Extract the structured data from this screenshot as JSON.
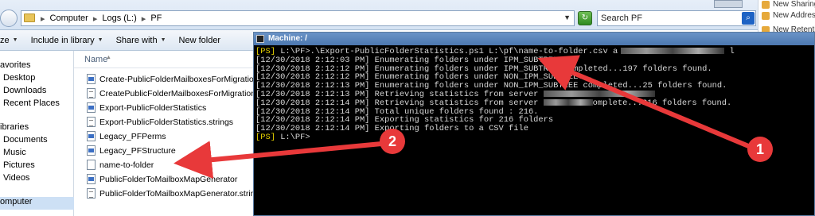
{
  "address": {
    "crumbs": [
      "Computer",
      "Logs (L:)",
      "PF"
    ],
    "separator": "▸"
  },
  "search": {
    "placeholder": "Search PF"
  },
  "outlook_panel": {
    "items": [
      "New Sharing",
      "New Address",
      "New Retenti"
    ]
  },
  "toolbar": {
    "organize_label": "ze",
    "include_label": "Include in library",
    "share_label": "Share with",
    "new_folder_label": "New folder"
  },
  "nav": {
    "favorites_head": "avorites",
    "favorites": [
      "Desktop",
      "Downloads",
      "Recent Places"
    ],
    "libraries_head": "ibraries",
    "libraries": [
      "Documents",
      "Music",
      "Pictures",
      "Videos"
    ],
    "computer_label": "omputer"
  },
  "filelist": {
    "column_name": "Name",
    "files": [
      {
        "name": "Create-PublicFolderMailboxesForMigration",
        "icon": "powershell-script-icon"
      },
      {
        "name": "CreatePublicFolderMailboxesForMigration.stri...",
        "icon": "strings-file-icon"
      },
      {
        "name": "Export-PublicFolderStatistics",
        "icon": "powershell-script-icon"
      },
      {
        "name": "Export-PublicFolderStatistics.strings",
        "icon": "strings-file-icon"
      },
      {
        "name": "Legacy_PFPerms",
        "icon": "powershell-script-icon"
      },
      {
        "name": "Legacy_PFStructure",
        "icon": "powershell-script-icon"
      },
      {
        "name": "name-to-folder",
        "icon": "text-file-icon"
      },
      {
        "name": "PublicFolderToMailboxMapGenerator",
        "icon": "powershell-script-icon"
      },
      {
        "name": "PublicFolderToMailboxMapGenerator.strings",
        "icon": "strings-file-icon"
      }
    ]
  },
  "console": {
    "title": "Machine: /",
    "prompt1": "[PS]",
    "command": " L:\\PF>.\\Export-PublicFolderStatistics.ps1 L:\\pf\\name-to-folder.csv a",
    "tail1": "l",
    "lines": [
      "[12/30/2018 2:12:03 PM] Enumerating folders under IPM_SUBTREE...",
      "[12/30/2018 2:12:12 PM] Enumerating folders under IPM_SUBTREE completed...197 folders found.",
      "[12/30/2018 2:12:12 PM] Enumerating folders under NON_IPM_SUBTREE...",
      "[12/30/2018 2:12:13 PM] Enumerating folders under NON_IPM_SUBTREE completed...25 folders found.",
      "[12/30/2018 2:12:13 PM] Retrieving statistics from server "
    ],
    "line6_pre": "[12/30/2018 2:12:14 PM] Retrieving statistics from server ",
    "line6_post": "omplete...216 folders found.",
    "lines2": [
      "[12/30/2018 2:12:14 PM] Total unique folders found : 216.",
      "[12/30/2018 2:12:14 PM] Exporting statistics for 216 folders",
      "[12/30/2018 2:12:14 PM] Exporting folders to a CSV file"
    ],
    "prompt2": "[PS]",
    "prompt2_path": " L:\\PF>"
  },
  "callouts": {
    "one": "1",
    "two": "2"
  },
  "colors": {
    "arrow": "#e8393a",
    "console_bg": "#000000",
    "ps_prompt": "#e6d200"
  }
}
